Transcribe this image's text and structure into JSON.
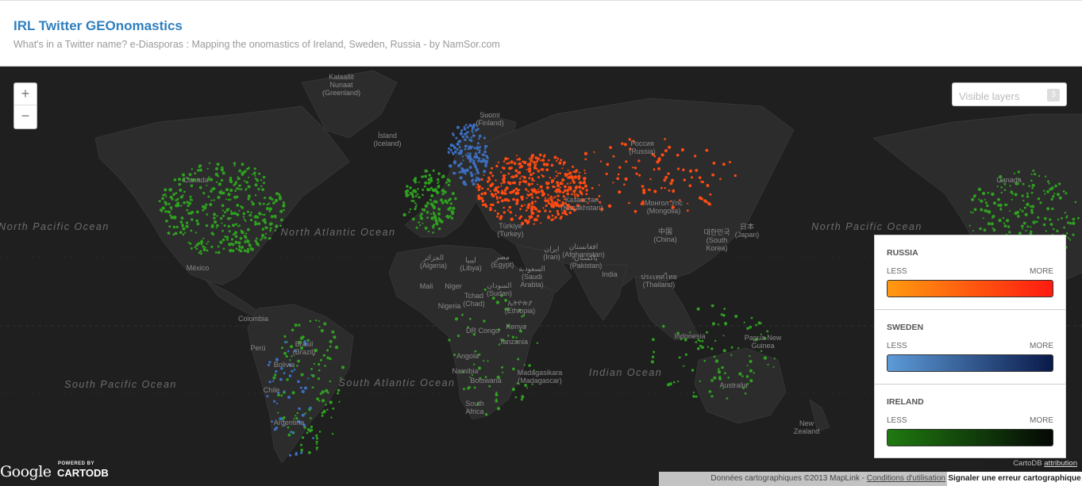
{
  "header": {
    "title": "IRL Twitter GEOnomastics",
    "subtitle": "What's in a Twitter name? e-Diasporas : Mapping the onomastics of Ireland, Sweden, Russia - by NamSor.com"
  },
  "controls": {
    "zoom_in": "+",
    "zoom_out": "−",
    "layers_placeholder": "Visible layers",
    "layers_count": "3"
  },
  "legend": [
    {
      "name": "RUSSIA",
      "less": "LESS",
      "more": "MORE",
      "from": "#ff9a10",
      "to": "#ff1a10"
    },
    {
      "name": "SWEDEN",
      "less": "LESS",
      "more": "MORE",
      "from": "#5d9bd8",
      "to": "#0a1a4a"
    },
    {
      "name": "IRELAND",
      "less": "LESS",
      "more": "MORE",
      "from": "#1f7a10",
      "to": "#050805"
    }
  ],
  "oceans": [
    "North Pacific Ocean",
    "North Atlantic Ocean",
    "North Pacific Ocean",
    "South Pacific Ocean",
    "South Atlantic Ocean",
    "Indian Ocean"
  ],
  "places": [
    "Kalaallit Nunaat (Greenland)",
    "Ísland (Iceland)",
    "Suomi (Finland)",
    "Россия (Russia)",
    "Canada",
    "Canada",
    "Казахстан (Kazakhstan)",
    "Монгол Улс (Mongolia)",
    "中国 (China)",
    "日本 (Japan)",
    "대한민국 (South Korea)",
    "Türkiye (Turkey)",
    "الجزائر (Algeria)",
    "ليبيا (Libya)",
    "مصر (Egypt)",
    "ایران (Iran)",
    "افغانستان (Afghanistan)",
    "پاکستان (Pakistan)",
    "India",
    "السعودية (Saudi Arabia)",
    "Mali",
    "Niger",
    "Tchad (Chad)",
    "السودان (Sudan)",
    "ኢትዮጵያ (Ethiopia)",
    "Nigeria",
    "DR Congo",
    "Kenya",
    "Tanzania",
    "Angola",
    "Namibia",
    "Botswana",
    "South Africa",
    "Madagasikara (Madagascar)",
    "ประเทศไทย (Thailand)",
    "Indonesia",
    "Papua New Guinea",
    "Australia",
    "New Zealand",
    "México",
    "Colombia",
    "Perú",
    "Brasil (Brazil)",
    "Bolivia",
    "Chile",
    "Argentina"
  ],
  "branding": {
    "google": "Google",
    "powered": "POWERED BY",
    "cartodb": "CARTODB"
  },
  "attribution": {
    "cartodb": "CartoDB",
    "cartodb_link": "attribution",
    "map_data": "Données cartographiques ©2013 MapLink -",
    "terms": "Conditions d'utilisation",
    "report": "Signaler une erreur cartographique"
  },
  "colors": {
    "russia": "#ff4a12",
    "sweden": "#3c6fc0",
    "ireland": "#2fa020",
    "map_bg": "#1f1f1f",
    "land": "#2b2b2b",
    "title": "#2f7fbf"
  }
}
